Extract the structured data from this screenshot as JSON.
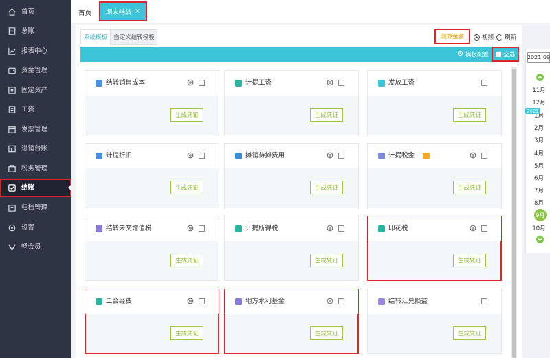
{
  "sidebar": {
    "items": [
      {
        "label": "首页",
        "icon": "home-icon"
      },
      {
        "label": "总账",
        "icon": "ledger-icon"
      },
      {
        "label": "报表中心",
        "icon": "chart-icon"
      },
      {
        "label": "资金管理",
        "icon": "wallet-icon"
      },
      {
        "label": "固定资产",
        "icon": "asset-icon"
      },
      {
        "label": "工资",
        "icon": "salary-icon"
      },
      {
        "label": "发票管理",
        "icon": "invoice-icon"
      },
      {
        "label": "进销台账",
        "icon": "inventory-icon"
      },
      {
        "label": "税务管理",
        "icon": "tax-icon"
      },
      {
        "label": "结账",
        "icon": "closing-icon"
      },
      {
        "label": "归档管理",
        "icon": "archive-icon"
      },
      {
        "label": "设置",
        "icon": "gear-icon"
      },
      {
        "label": "畅会员",
        "icon": "vip-icon"
      }
    ]
  },
  "topbar": {
    "home_label": "首页",
    "active_tab_label": "期末结转",
    "close_glyph": "×"
  },
  "panel": {
    "subtabs": [
      "系统模板",
      "自定义结转模板"
    ],
    "calc_label": "测算金额",
    "video_label": "视频",
    "refresh_label": "刷新",
    "template_config_label": "模板配置",
    "select_all_label": "全选"
  },
  "cards": [
    {
      "title": "结转销售成本",
      "button": "生成凭证",
      "icon_color": "#4a90e2",
      "has_gear": true
    },
    {
      "title": "计提工资",
      "button": "生成凭证",
      "icon_color": "#2bb5a0",
      "has_gear": true
    },
    {
      "title": "发放工资",
      "button": "生成凭证",
      "icon_color": "#3cc4d8",
      "has_gear": false
    },
    {
      "title": "计提折旧",
      "button": "生成凭证",
      "icon_color": "#4a90e2",
      "has_gear": true
    },
    {
      "title": "摊销待摊费用",
      "button": "生成凭证",
      "icon_color": "#3b8fd6",
      "has_gear": true
    },
    {
      "title": "计提税金",
      "button": "生成凭证",
      "icon_color": "#7b8bd8",
      "has_gear": true
    },
    {
      "title": "结转未交增值税",
      "button": "生成凭证",
      "icon_color": "#8a79d6",
      "has_gear": true
    },
    {
      "title": "计提所得税",
      "button": "生成凭证",
      "icon_color": "#2bb5a0",
      "has_gear": true
    },
    {
      "title": "印花税",
      "button": "生成凭证",
      "icon_color": "#2bb5a0",
      "has_gear": true
    },
    {
      "title": "工会经费",
      "button": "生成凭证",
      "icon_color": "#2bb5a0",
      "has_gear": true
    },
    {
      "title": "地方水利基金",
      "button": "生成凭证",
      "icon_color": "#8a79d6",
      "has_gear": true
    },
    {
      "title": "结转汇兑损益",
      "button": "生成凭证",
      "icon_color": "#9a84e0",
      "has_gear": false
    }
  ],
  "calendar": {
    "year_label": "2021.09",
    "year_tag": "2021",
    "months": [
      "11月",
      "12月",
      "1月",
      "2月",
      "3月",
      "4月",
      "5月",
      "6月",
      "7月",
      "8月",
      "9月",
      "10月"
    ],
    "current": "9月"
  },
  "colors": {
    "accent": "#3cc4d8",
    "sidebar_bg": "#2f3444",
    "highlight": "#d9252b",
    "button_green": "#8ab82a"
  }
}
